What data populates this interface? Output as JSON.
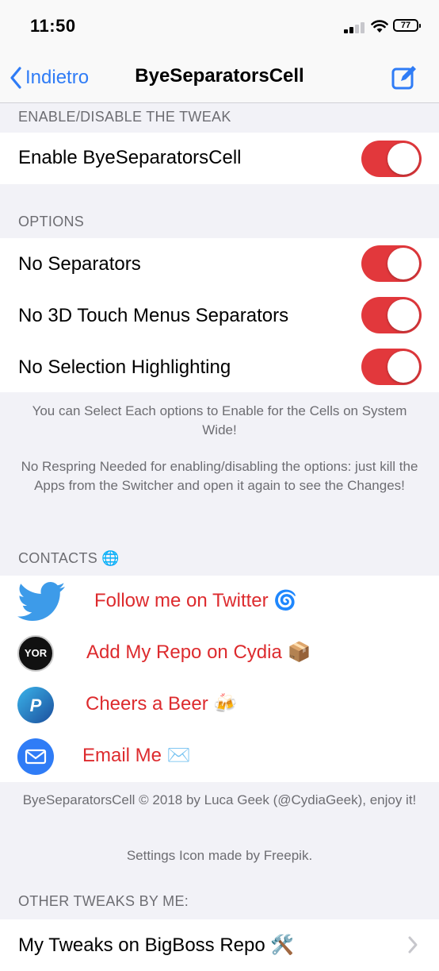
{
  "status_bar": {
    "time": "11:50",
    "battery": "77"
  },
  "nav": {
    "back_label": "Indietro",
    "title": "ByeSeparatorsCell"
  },
  "sections": {
    "enable_header": "ENABLE/DISABLE THE TWEAK",
    "options_header": "OPTIONS",
    "contacts_header": "CONTACTS 🌐",
    "other_header": "OTHER TWEAKS BY ME:"
  },
  "enable": {
    "label": "Enable ByeSeparatorsCell",
    "on": true
  },
  "options": [
    {
      "label": "No Separators",
      "on": true
    },
    {
      "label": "No 3D Touch Menus Separators",
      "on": true
    },
    {
      "label": "No Selection Highlighting",
      "on": true
    }
  ],
  "options_footer": {
    "p1": "You can Select Each options to Enable for the Cells on System Wide!",
    "p2": "No Respring Needed for enabling/disabling the options: just kill the Apps from the Switcher and open it again to see the Changes!"
  },
  "contacts": [
    {
      "label": "Follow me on Twitter 🌀",
      "icon": "twitter-bird-icon"
    },
    {
      "label": "Add My Repo on Cydia 📦",
      "icon": "repo-logo-icon",
      "logo_text": "YOR"
    },
    {
      "label": "Cheers a Beer 🍻",
      "icon": "paypal-icon"
    },
    {
      "label": "Email Me ✉️",
      "icon": "mail-icon"
    }
  ],
  "credits": {
    "line1": "ByeSeparatorsCell © 2018 by Luca Geek (@CydiaGeek), enjoy it!",
    "line2": "Settings Icon made by Freepik."
  },
  "other": {
    "label": "My Tweaks on BigBoss Repo 🛠️"
  },
  "colors": {
    "accent": "#2f7cf6",
    "toggle_on": "#e2383c",
    "link_red": "#dd2b2e"
  }
}
